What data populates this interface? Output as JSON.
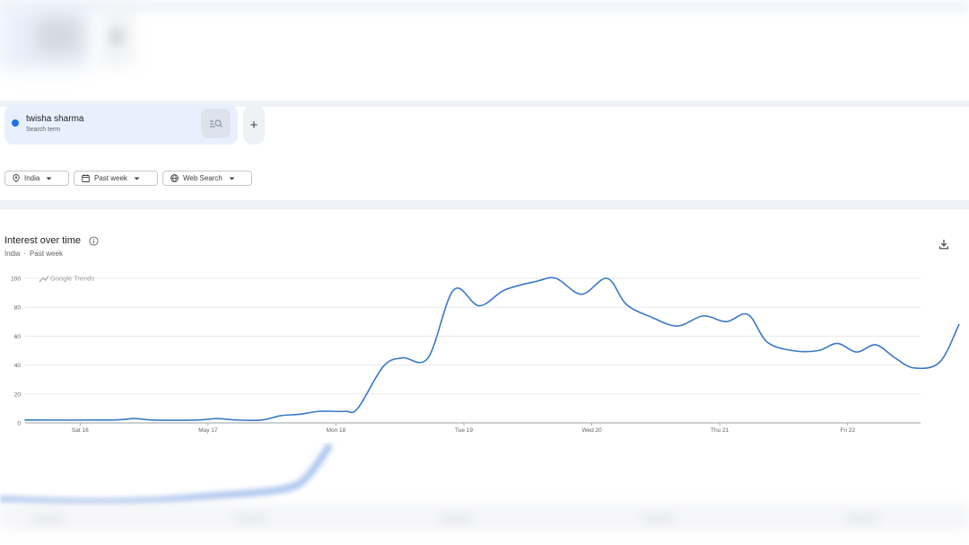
{
  "search": {
    "term": "twisha sharma",
    "term_type": "Search term",
    "term_color": "#1a73e8",
    "add_label": "+"
  },
  "filters": {
    "region": "India",
    "period": "Past week",
    "property": "Web Search"
  },
  "chart_section": {
    "title": "Interest over time",
    "subtitle_region": "India",
    "subtitle_separator": "·",
    "subtitle_period": "Past week",
    "watermark": "Google Trends"
  },
  "chart_data": {
    "type": "line",
    "ylim": [
      0,
      100
    ],
    "y_ticks": [
      0,
      20,
      40,
      60,
      80,
      100
    ],
    "x_range": [
      0,
      7
    ],
    "x_ticks": [
      {
        "x": 0.43,
        "label": "Sat 16"
      },
      {
        "x": 1.43,
        "label": "May 17"
      },
      {
        "x": 2.43,
        "label": "Mon 18"
      },
      {
        "x": 3.43,
        "label": "Tue 19"
      },
      {
        "x": 4.43,
        "label": "Wed 20"
      },
      {
        "x": 5.43,
        "label": "Thu 21"
      },
      {
        "x": 6.43,
        "label": "Fri 22"
      }
    ],
    "grid": true,
    "line_color": "#3a79c7",
    "series": [
      {
        "points": [
          [
            0.0,
            2
          ],
          [
            0.67,
            2
          ],
          [
            0.85,
            3
          ],
          [
            1.0,
            2
          ],
          [
            1.35,
            2
          ],
          [
            1.5,
            3
          ],
          [
            1.65,
            2
          ],
          [
            1.85,
            2
          ],
          [
            2.0,
            5
          ],
          [
            2.15,
            6
          ],
          [
            2.3,
            8
          ],
          [
            2.5,
            8
          ],
          [
            2.6,
            10
          ],
          [
            2.8,
            39
          ],
          [
            2.95,
            45
          ],
          [
            3.15,
            45
          ],
          [
            3.35,
            92
          ],
          [
            3.55,
            81
          ],
          [
            3.75,
            92
          ],
          [
            4.0,
            98
          ],
          [
            4.15,
            100
          ],
          [
            4.35,
            89
          ],
          [
            4.55,
            100
          ],
          [
            4.7,
            82
          ],
          [
            4.9,
            73
          ],
          [
            5.1,
            67
          ],
          [
            5.3,
            74
          ],
          [
            5.48,
            70
          ],
          [
            5.65,
            75
          ],
          [
            5.8,
            56
          ],
          [
            6.0,
            50
          ],
          [
            6.2,
            50
          ],
          [
            6.35,
            55
          ],
          [
            6.5,
            49
          ],
          [
            6.65,
            54
          ],
          [
            6.8,
            45
          ],
          [
            6.95,
            38
          ],
          [
            7.15,
            42
          ],
          [
            7.3,
            68
          ]
        ]
      }
    ]
  },
  "colors": {
    "accent": "#1a73e8",
    "divider": "#eef1f6",
    "card_bg": "#e9f0fd"
  }
}
